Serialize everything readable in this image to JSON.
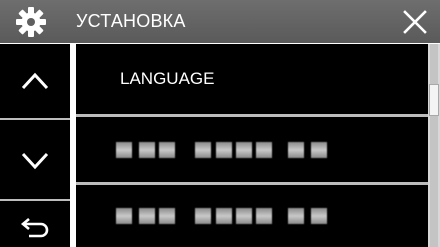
{
  "header": {
    "title": "УСТАНОВКА",
    "settings_icon": "gear-icon",
    "close_icon": "close-icon"
  },
  "nav": {
    "up_icon": "chevron-up-icon",
    "down_icon": "chevron-down-icon",
    "back_icon": "back-arrow-icon"
  },
  "menu": {
    "items": [
      {
        "label": "LANGUAGE"
      },
      {
        "label": ""
      },
      {
        "label": ""
      }
    ]
  },
  "colors": {
    "title_bar": "#5f5f5f",
    "background": "#000000",
    "separator": "#bcbcbc",
    "text": "#ffffff"
  }
}
